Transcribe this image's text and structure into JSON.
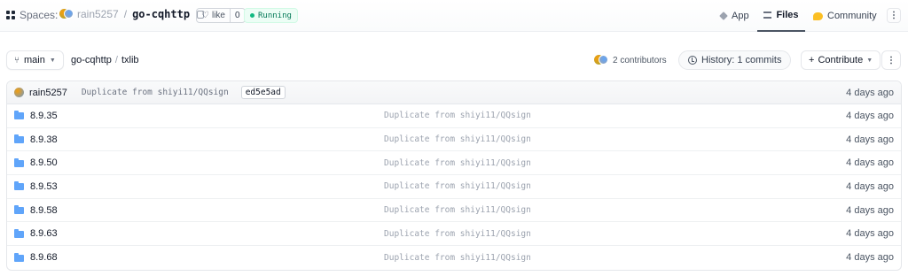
{
  "header": {
    "spaces_label": "Spaces:",
    "owner": "rain5257",
    "separator": "/",
    "repo": "go-cqhttp",
    "like_label": "like",
    "like_count": "0",
    "status": "Running",
    "status_color": "#10b981",
    "nav": {
      "app": "App",
      "files": "Files",
      "community": "Community"
    },
    "more": "⋮"
  },
  "toolbar": {
    "branch": "main",
    "path": [
      "go-cqhttp",
      "txlib"
    ],
    "path_separator": "/",
    "contributors": "2 contributors",
    "history": "History: 1 commits",
    "contribute": "Contribute",
    "more": "⋮"
  },
  "commit": {
    "author": "rain5257",
    "message": "Duplicate from shiyi11/QQsign",
    "hash": "ed5e5ad",
    "time": "4 days ago"
  },
  "files": [
    {
      "name": "8.9.35",
      "message": "Duplicate from shiyi11/QQsign",
      "time": "4 days ago"
    },
    {
      "name": "8.9.38",
      "message": "Duplicate from shiyi11/QQsign",
      "time": "4 days ago"
    },
    {
      "name": "8.9.50",
      "message": "Duplicate from shiyi11/QQsign",
      "time": "4 days ago"
    },
    {
      "name": "8.9.53",
      "message": "Duplicate from shiyi11/QQsign",
      "time": "4 days ago"
    },
    {
      "name": "8.9.58",
      "message": "Duplicate from shiyi11/QQsign",
      "time": "4 days ago"
    },
    {
      "name": "8.9.63",
      "message": "Duplicate from shiyi11/QQsign",
      "time": "4 days ago"
    },
    {
      "name": "8.9.68",
      "message": "Duplicate from shiyi11/QQsign",
      "time": "4 days ago"
    }
  ]
}
